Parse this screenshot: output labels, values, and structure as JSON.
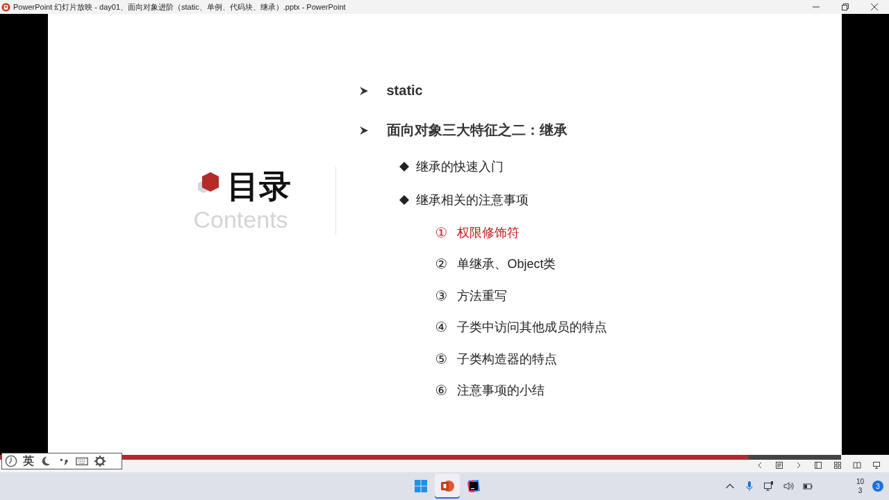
{
  "window": {
    "title": "PowerPoint 幻灯片放映  -  day01、面向对象进阶（static、单例、代码块、继承）.pptx - PowerPoint"
  },
  "slide": {
    "heading": "目录",
    "subheading": "Contents",
    "outline": [
      {
        "text": "static"
      },
      {
        "text": "面向对象三大特征之二：继承",
        "children": [
          {
            "text": "继承的快速入门"
          },
          {
            "text": "继承相关的注意事项",
            "children": [
              {
                "number": "①",
                "text": "权限修饰符",
                "highlighted": true
              },
              {
                "number": "②",
                "text": "单继承、Object类",
                "highlighted": false
              },
              {
                "number": "③",
                "text": "方法重写",
                "highlighted": false
              },
              {
                "number": "④",
                "text": "子类中访问其他成员的特点",
                "highlighted": false
              },
              {
                "number": "⑤",
                "text": "子类构造器的特点",
                "highlighted": false
              },
              {
                "number": "⑥",
                "text": "注意事项的小结",
                "highlighted": false
              }
            ]
          }
        ]
      }
    ]
  },
  "slideshow": {
    "progress": {
      "level": 0.89
    }
  },
  "ime_toolbar": {
    "mode": "英"
  },
  "taskbar": {
    "clock": [
      "10",
      "3"
    ],
    "notifications": "3"
  }
}
